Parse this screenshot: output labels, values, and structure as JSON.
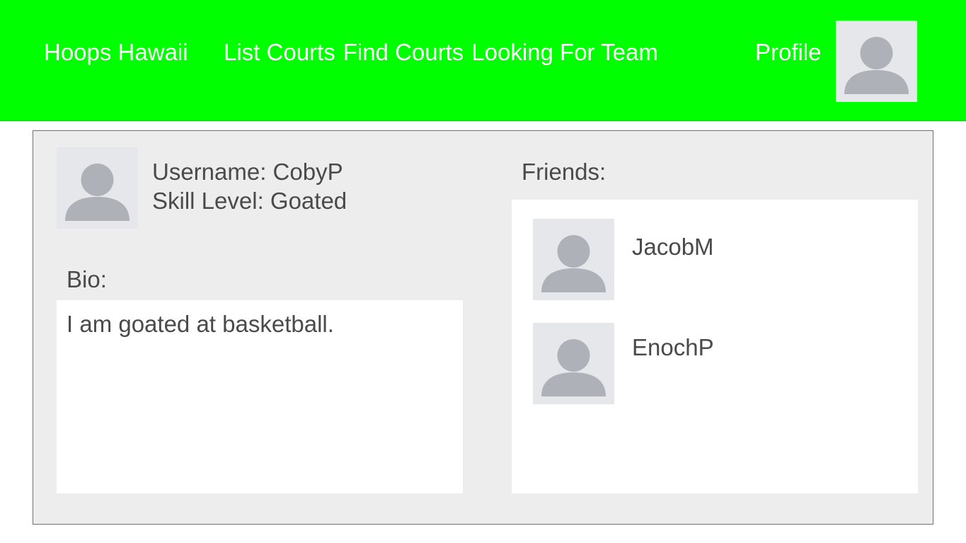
{
  "nav": {
    "brand": "Hoops Hawaii",
    "links": [
      "List Courts",
      "Find Courts",
      "Looking For Team"
    ],
    "profile": "Profile",
    "avatar_icon": "user-silhouette-icon",
    "color": "#00ff00"
  },
  "profile": {
    "username": "Username: CobyP",
    "skill_level": "Skill Level: Goated",
    "bio_label": "Bio:",
    "bio": "I am goated at basketball.",
    "friends_label": "Friends:",
    "friends": [
      "JacobM",
      "EnochP"
    ]
  }
}
